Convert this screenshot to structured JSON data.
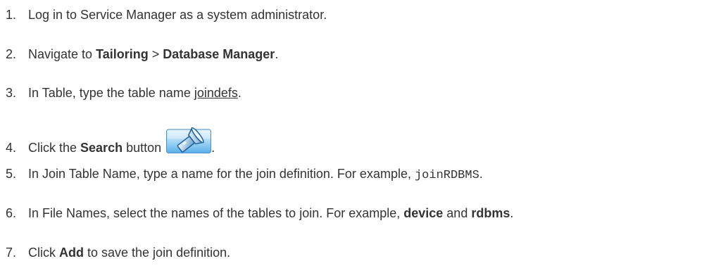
{
  "steps": [
    {
      "num": "1.",
      "text": "Log in to Service Manager as a system administrator."
    },
    {
      "num": "2.",
      "pre": "Navigate to ",
      "b1": "Tailoring",
      "sep": " > ",
      "b2": "Database Manager",
      "post": "."
    },
    {
      "num": "3.",
      "pre": "In Table, type the table name ",
      "link": "joindefs",
      "post": "."
    },
    {
      "num": "4.",
      "pre": "Click the ",
      "bold": "Search",
      "mid": " button ",
      "icon": "search-flashlight-icon",
      "post": "."
    },
    {
      "num": "5.",
      "pre": "In Join Table Name, type a name for the join definition. For example, ",
      "code": "joinRDBMS",
      "post": "."
    },
    {
      "num": "6.",
      "pre": "In File Names, select the names of the tables to join. For example, ",
      "b1": "device",
      "mid": " and ",
      "b2": "rdbms",
      "post": "."
    },
    {
      "num": "7.",
      "pre": "Click ",
      "bold": "Add",
      "post": " to save the join definition."
    }
  ]
}
